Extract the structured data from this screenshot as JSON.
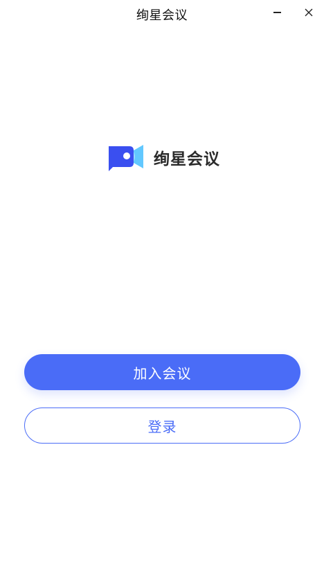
{
  "window": {
    "title": "绚星会议",
    "minimize_symbol": "–",
    "close_symbol": "X"
  },
  "logo": {
    "icon": "camera-chat-icon",
    "text": "绚星会议"
  },
  "actions": {
    "join_label": "加入会议",
    "login_label": "登录"
  },
  "colors": {
    "accent": "#4a6cf7",
    "logo_dark": "#3a4ff0",
    "logo_light": "#62c8ff"
  }
}
